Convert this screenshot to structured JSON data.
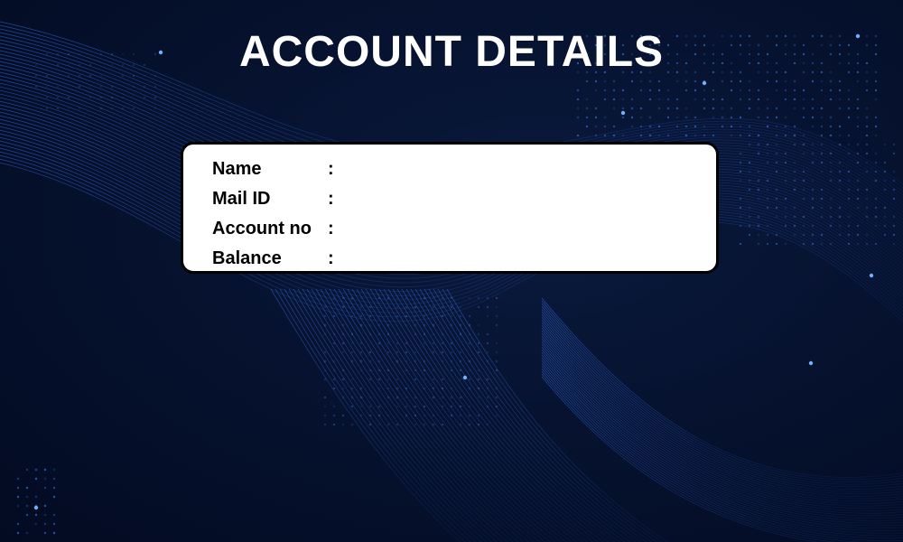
{
  "title": "ACCOUNT DETAILS",
  "fields": [
    {
      "label": "Name",
      "separator": ":",
      "value": ""
    },
    {
      "label": "Mail ID",
      "separator": ":",
      "value": ""
    },
    {
      "label": "Account no",
      "separator": ":",
      "value": ""
    },
    {
      "label": "Balance",
      "separator": ":",
      "value": ""
    }
  ],
  "colors": {
    "background": "#06122f",
    "accent": "#2a7bff",
    "card": "#ffffff",
    "title": "#ffffff"
  }
}
